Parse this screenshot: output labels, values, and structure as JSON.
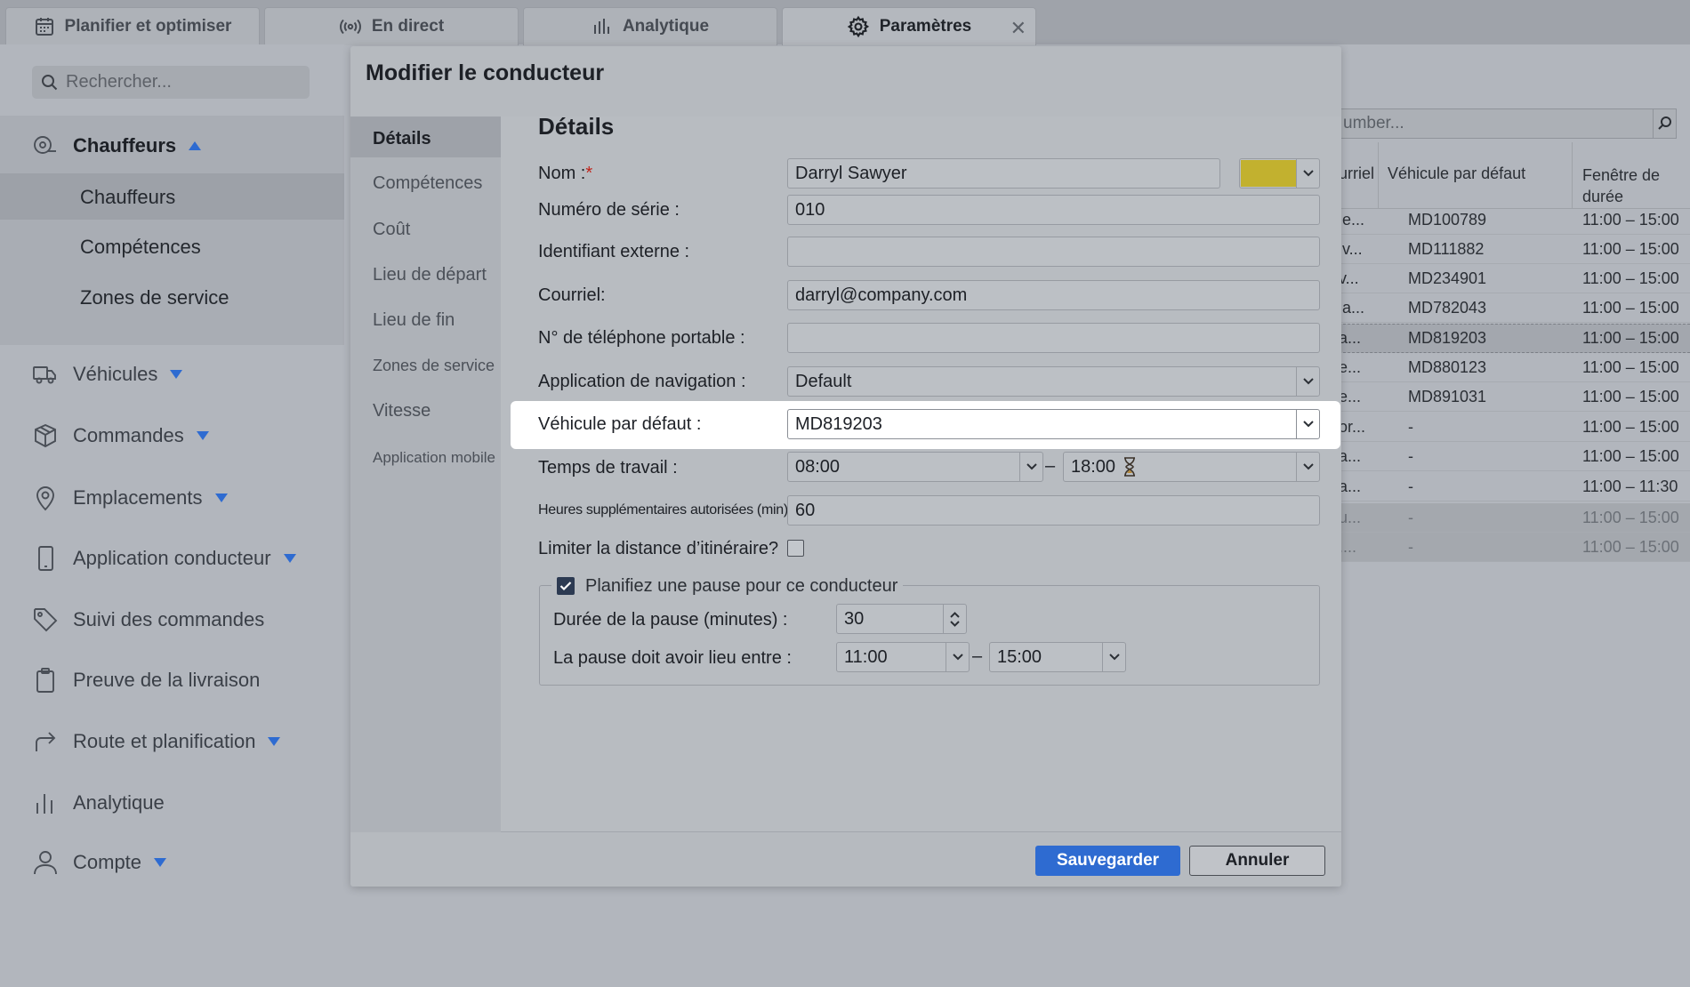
{
  "tabs": [
    {
      "label": "Planifier et optimiser",
      "icon": "calendar-icon"
    },
    {
      "label": "En direct",
      "icon": "broadcast-icon"
    },
    {
      "label": "Analytique",
      "icon": "bar-chart-icon"
    },
    {
      "label": "Paramètres",
      "icon": "gear-icon",
      "active": true,
      "close": "✕"
    }
  ],
  "sidebar": {
    "search_placeholder": "Rechercher...",
    "section": {
      "label": "Chauffeurs",
      "icon": "driver-icon"
    },
    "sub_items": [
      "Chauffeurs",
      "Compétences",
      "Zones de service"
    ],
    "items": [
      {
        "label": "Véhicules",
        "icon": "truck-icon",
        "expandable": true
      },
      {
        "label": "Commandes",
        "icon": "box-icon",
        "expandable": true
      },
      {
        "label": "Emplacements",
        "icon": "map-pin-icon",
        "expandable": true
      },
      {
        "label": "Application conducteur",
        "icon": "mobile-icon",
        "expandable": true
      },
      {
        "label": "Suivi des commandes",
        "icon": "tag-icon",
        "expandable": false
      },
      {
        "label": "Preuve de la livraison",
        "icon": "clipboard-icon",
        "expandable": false
      },
      {
        "label": "Route et planification",
        "icon": "route-icon",
        "expandable": true
      },
      {
        "label": "Analytique",
        "icon": "bar-chart-icon",
        "expandable": false
      },
      {
        "label": "Compte",
        "icon": "user-icon",
        "expandable": true
      }
    ]
  },
  "background_table": {
    "search_placeholder": "umber...",
    "headers": [
      "urriel",
      "Véhicule par défaut",
      "Fenêtre de durée"
    ],
    "rows": [
      [
        "le...",
        "MD100789",
        "11:00 – 15:00"
      ],
      [
        "lv...",
        "MD111882",
        "11:00 – 15:00"
      ],
      [
        "v...",
        "MD234901",
        "11:00 – 15:00"
      ],
      [
        "la...",
        "MD782043",
        "11:00 – 15:00"
      ],
      [
        "a...",
        "MD819203",
        "11:00 – 15:00"
      ],
      [
        "e...",
        "MD880123",
        "11:00 – 15:00"
      ],
      [
        "e...",
        "MD891031",
        "11:00 – 15:00"
      ],
      [
        "or...",
        "-",
        "11:00 – 15:00"
      ],
      [
        "a...",
        "-",
        "11:00 – 15:00"
      ],
      [
        "a...",
        "-",
        "11:00 – 11:30"
      ],
      [
        "u...",
        "-",
        "11:00 – 15:00"
      ],
      [
        "....",
        "-",
        "11:00 – 15:00"
      ]
    ]
  },
  "modal": {
    "title": "Modifier le conducteur",
    "nav": [
      "Détails",
      "Compétences",
      "Coût",
      "Lieu de départ",
      "Lieu de fin",
      "Zones de service",
      "Vitesse",
      "Application mobile"
    ],
    "section_title": "Détails",
    "fields": {
      "name_label": "Nom :",
      "required_mark": "*",
      "name_value": "Darryl Sawyer",
      "driver_color": "#c2b12f",
      "serial_label": "Numéro de série :",
      "serial_value": "010",
      "external_id_label": "Identifiant externe :",
      "external_id_value": "",
      "email_label": "Courriel:",
      "email_value": "darryl@company.com",
      "mobile_label": "N° de téléphone portable :",
      "mobile_value": "",
      "nav_app_label": "Application de navigation :",
      "nav_app_value": "Default",
      "vehicle_label": "Véhicule par défaut :",
      "vehicle_value": "MD819203",
      "work_time_label": "Temps de travail :",
      "work_start": "08:00",
      "work_end": "18:00",
      "time_separator": "–",
      "overtime_label": "Heures supplémentaires autorisées (min) :",
      "overtime_value": "60",
      "limit_distance_label": "Limiter la distance d’itinéraire?",
      "limit_distance_checked": false
    },
    "break": {
      "checkbox_label": "Planifiez une pause pour ce conducteur",
      "checked": true,
      "duration_label": "Durée de la pause (minutes) :",
      "duration_value": "30",
      "window_label": "La pause doit avoir lieu entre :",
      "window_start": "11:00",
      "window_end": "15:00"
    },
    "save_label": "Sauvegarder",
    "cancel_label": "Annuler"
  },
  "colors": {
    "accent": "#2e6bd1",
    "highlight": "#ffffff"
  }
}
